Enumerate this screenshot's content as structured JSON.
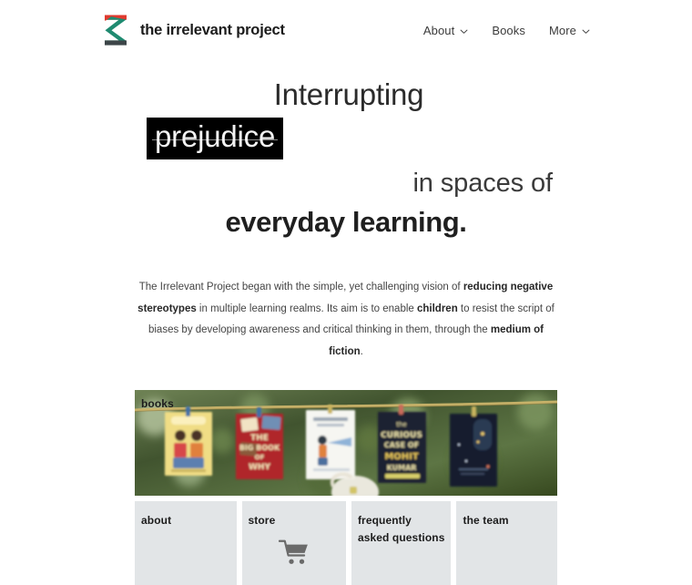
{
  "header": {
    "brand": {
      "name": "the irrelevant project",
      "logo_icon": "irrelevant-project-z-logo",
      "logo_colors": {
        "top_bar": "#e03a2f",
        "diagonal": "#1f8a70",
        "bottom_bar": "#3d4548"
      }
    },
    "nav": [
      {
        "label": "About",
        "has_dropdown": true,
        "caret_icon": "chevron-down-icon"
      },
      {
        "label": "Books",
        "has_dropdown": false,
        "caret_icon": ""
      },
      {
        "label": "More",
        "has_dropdown": true,
        "caret_icon": "chevron-down-icon"
      }
    ]
  },
  "hero": {
    "line1": "Interrupting",
    "line2_struck": "prejudice",
    "line3": "in spaces of",
    "line4": "everyday learning.",
    "highlight_bg": "#000000",
    "highlight_fg": "#f2f2f2"
  },
  "intro": {
    "part1": "The Irrelevant Project began with the simple, yet challenging vision of ",
    "bold1": "reducing negative stereotypes",
    "part2": " in multiple learning realms. Its aim is to enable ",
    "bold2": "children",
    "part3": " to resist the script of biases by developing awareness and critical thinking in them, through the ",
    "bold3": "medium of fiction",
    "part4": "."
  },
  "tiles": {
    "banner": {
      "label": "books",
      "image_alt": "children's book covers pegged on a clothesline outdoors"
    },
    "items": [
      {
        "label": "about",
        "icon": ""
      },
      {
        "label": "store",
        "icon": "shopping-cart-icon"
      },
      {
        "label": "frequently asked questions",
        "icon": ""
      },
      {
        "label": "the team",
        "icon": ""
      }
    ]
  },
  "colors": {
    "tile_bg": "#e2e5e7",
    "text": "#2e2e2e"
  }
}
